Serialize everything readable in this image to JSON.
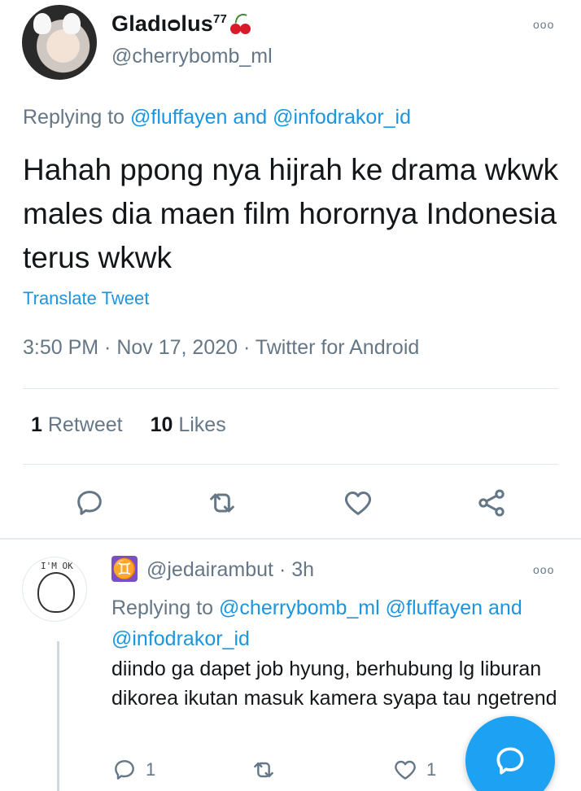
{
  "main_tweet": {
    "display_name": "Gladιᴑlus",
    "display_name_sup": "77",
    "handle": "@cherrybomb_ml",
    "replying_prefix": "Replying to",
    "replying_mention_1": "@fluffayen",
    "replying_and": "and",
    "replying_mention_2": "@infodrakor_id",
    "text": "Hahah ppong nya hijrah ke drama wkwk males dia maen film horornya Indonesia terus wkwk",
    "translate_label": "Translate Tweet",
    "meta": "3:50 PM · Nov 17, 2020 · Twitter for Android",
    "retweet_count": "1",
    "retweet_label": "Retweet",
    "like_count": "10",
    "like_label": "Likes"
  },
  "reply_tweet": {
    "badge_glyph": "♊",
    "handle_time": "@jedairambut · 3h",
    "replying_prefix": "Replying to",
    "replying_mention_1": "@cherrybomb_ml",
    "replying_mention_2": "@fluffayen",
    "replying_and": "and",
    "replying_mention_3": "@infodrakor_id",
    "text": "diindo ga dapet job hyung, berhubung lg liburan dikorea ikutan masuk kamera syapa tau ngetrend",
    "reply_count": "1",
    "like_count": "1",
    "avatar_text": "I'M OK"
  },
  "icons": {
    "more": "ooo",
    "reply": "reply-icon",
    "retweet": "retweet-icon",
    "like": "heart-icon",
    "share": "share-icon",
    "compose": "compose-icon"
  },
  "colors": {
    "accent": "#1b95e0",
    "fab": "#1da1f2",
    "muted": "#657786",
    "text": "#14171a"
  }
}
